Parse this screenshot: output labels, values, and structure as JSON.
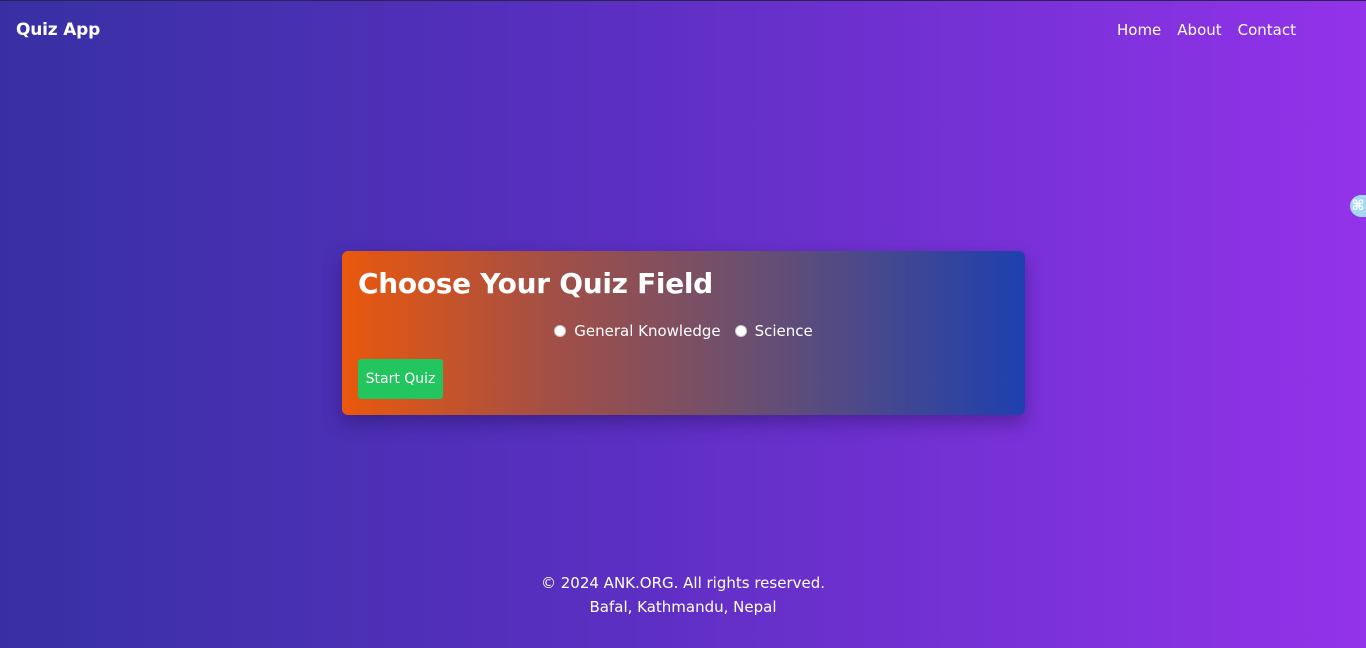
{
  "navbar": {
    "brand": "Quiz App",
    "links": [
      {
        "label": "Home"
      },
      {
        "label": "About"
      },
      {
        "label": "Contact"
      }
    ]
  },
  "side_widget": {
    "icon": "command-icon",
    "glyph": "⌘"
  },
  "card": {
    "title": "Choose Your Quiz Field",
    "options": [
      {
        "label": "General Knowledge",
        "checked": false
      },
      {
        "label": "Science",
        "checked": false
      }
    ],
    "start_button": "Start Quiz"
  },
  "footer": {
    "copyright": "© 2024 ANK.ORG. All rights reserved.",
    "address": "Bafal, Kathmandu, Nepal"
  },
  "colors": {
    "background_start": "#3730a3",
    "background_end": "#9333ea",
    "card_start": "#ea580c",
    "card_end": "#1e40af",
    "button": "#22c55e"
  }
}
